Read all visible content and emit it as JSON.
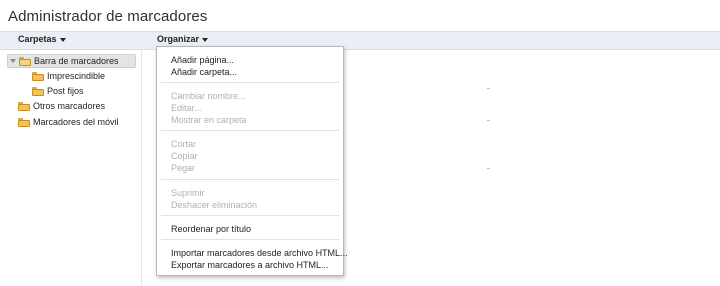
{
  "app": {
    "title": "Administrador de marcadores"
  },
  "header": {
    "folders_label": "Carpetas",
    "organize_label": "Organizar"
  },
  "tree": {
    "items": [
      {
        "label": "Barra de marcadores",
        "state": "expanded",
        "selected": true
      },
      {
        "label": "Imprescindible"
      },
      {
        "label": "Post fijos"
      },
      {
        "label": "Otros marcadores"
      },
      {
        "label": "Marcadores del móvil"
      }
    ]
  },
  "menu": {
    "groups": [
      [
        {
          "label": "Añadir página...",
          "enabled": true
        },
        {
          "label": "Añadir carpeta...",
          "enabled": true
        }
      ],
      [
        {
          "label": "Cambiar nombre...",
          "enabled": false
        },
        {
          "label": "Editar...",
          "enabled": false
        },
        {
          "label": "Mostrar en carpeta",
          "enabled": false
        }
      ],
      [
        {
          "label": "Cortar",
          "enabled": false
        },
        {
          "label": "Copiar",
          "enabled": false
        },
        {
          "label": "Pegar",
          "enabled": false
        }
      ],
      [
        {
          "label": "Suprimir",
          "enabled": false
        },
        {
          "label": "Deshacer eliminación",
          "enabled": false
        }
      ],
      [
        {
          "label": "Reordenar por título",
          "enabled": true
        }
      ],
      [
        {
          "label": "Importar marcadores desde archivo HTML...",
          "enabled": true
        },
        {
          "label": "Exportar marcadores a archivo HTML...",
          "enabled": true
        }
      ]
    ]
  },
  "colors": {
    "header_bar": "#eaeff6",
    "folder": "#f1c35a",
    "disabled_text": "#b0b0b0",
    "selected_row": "#e4e4e4"
  },
  "icons": {
    "folder": "folder-icon",
    "expander": "triangle-down-icon",
    "dropdown": "caret-down-icon"
  }
}
